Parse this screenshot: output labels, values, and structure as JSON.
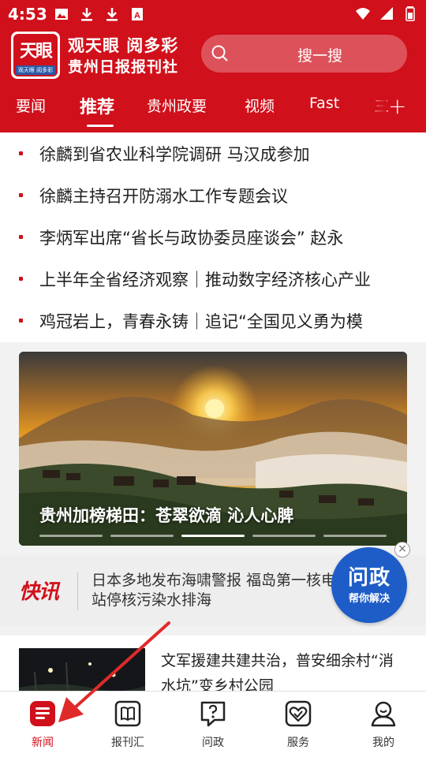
{
  "status_bar": {
    "time": "4:53",
    "left_icons": [
      "image-icon",
      "download-icon",
      "download-icon",
      "text-icon"
    ],
    "right_icons": [
      "wifi-icon",
      "signal-icon",
      "battery-icon"
    ]
  },
  "header": {
    "logo_text": "天眼",
    "logo_sub": "观天眼 阅多彩",
    "slogan_line1": "观天眼 阅多彩",
    "slogan_line2": "贵州日报报刊社",
    "search_placeholder": "搜一搜"
  },
  "tabs": [
    {
      "label": "要闻",
      "active": false
    },
    {
      "label": "推荐",
      "active": true
    },
    {
      "label": "贵州政要",
      "active": false
    },
    {
      "label": "视频",
      "active": false
    },
    {
      "label": "Fast",
      "active": false
    },
    {
      "label": "三",
      "active": false
    }
  ],
  "headlines": [
    "徐麟到省农业科学院调研  马汉成参加",
    "徐麟主持召开防溺水工作专题会议",
    "李炳军出席“省长与政协委员座谈会” 赵永",
    "上半年全省经济观察｜推动数字经济核心产业",
    "鸡冠岩上，青春永铸｜追记“全国见义勇为模"
  ],
  "banner": {
    "caption": "贵州加榜梯田：苍翠欲滴   沁人心脾",
    "slide_count": 5,
    "active_slide": 2
  },
  "flash": {
    "logo_text": "快讯",
    "text": "日本多地发布海啸警报 福岛第一核电站停核污染水排海"
  },
  "wenzheng_badge": {
    "title": "问政",
    "subtitle": "帮你解决",
    "close_label": "×"
  },
  "article": {
    "title": "文军援建共建共治，普安细余村“消水坑”变乡村公园"
  },
  "bottom_nav": [
    {
      "label": "新闻",
      "icon": "news-icon",
      "active": true
    },
    {
      "label": "报刊汇",
      "icon": "book-icon",
      "active": false
    },
    {
      "label": "问政",
      "icon": "question-icon",
      "active": false
    },
    {
      "label": "服务",
      "icon": "service-heart-icon",
      "active": false
    },
    {
      "label": "我的",
      "icon": "profile-icon",
      "active": false
    }
  ],
  "colors": {
    "brand_red": "#d0101b",
    "wenzheng_blue": "#1e5dc7",
    "annotation_arrow": "#e02a2a"
  }
}
